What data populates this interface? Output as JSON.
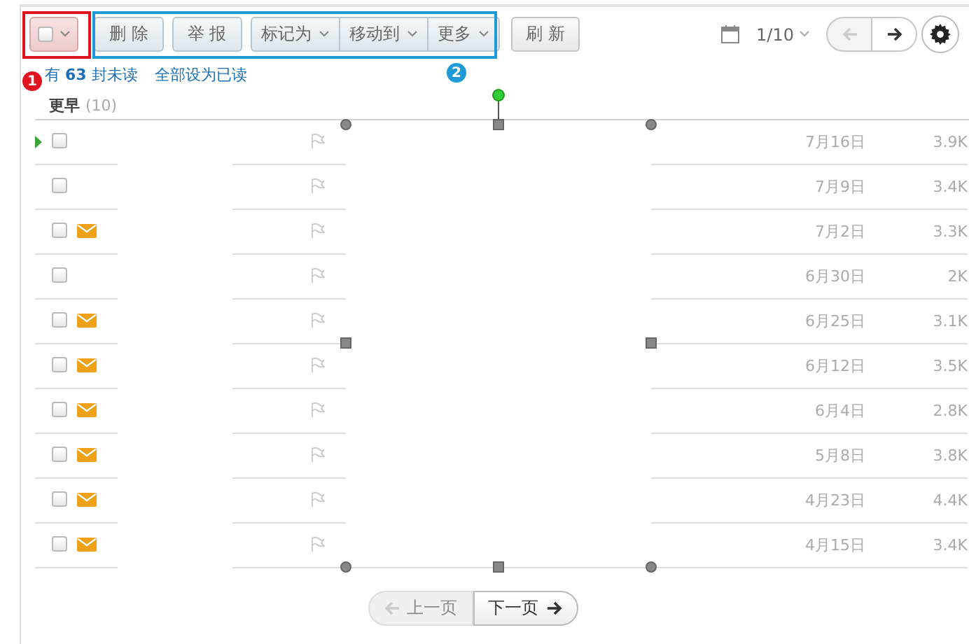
{
  "toolbar": {
    "select_all": {
      "checked": false
    },
    "delete_button": "删 除",
    "report_button": "举 报",
    "menu_group": [
      {
        "label": "标记为"
      },
      {
        "label": "移动到"
      },
      {
        "label": "更多"
      }
    ],
    "refresh_button": "刷 新",
    "page": "1/10",
    "prev": {
      "disabled": true
    },
    "next": {
      "disabled": false
    }
  },
  "annotations": [
    {
      "number": "1",
      "color": "#e0141e"
    },
    {
      "number": "2",
      "color": "#1e9bd7"
    }
  ],
  "unread_notice": "有 **63** 封未读",
  "mark_all_read": "全部设为已读",
  "group": {
    "title": "更早",
    "count": "(10)"
  },
  "rows": [
    {
      "current": true,
      "checked": false,
      "unread": false,
      "flagged": false,
      "date": "7月16日",
      "size": "3.9K"
    },
    {
      "current": false,
      "checked": false,
      "unread": false,
      "flagged": false,
      "date": "7月9日",
      "size": "3.4K"
    },
    {
      "current": false,
      "checked": false,
      "unread": true,
      "flagged": false,
      "date": "7月2日",
      "size": "3.3K"
    },
    {
      "current": false,
      "checked": false,
      "unread": false,
      "flagged": false,
      "date": "6月30日",
      "size": "2K"
    },
    {
      "current": false,
      "checked": false,
      "unread": true,
      "flagged": false,
      "date": "6月25日",
      "size": "3.1K"
    },
    {
      "current": false,
      "checked": false,
      "unread": true,
      "flagged": false,
      "date": "6月12日",
      "size": "3.5K"
    },
    {
      "current": false,
      "checked": false,
      "unread": true,
      "flagged": false,
      "date": "6月4日",
      "size": "2.8K"
    },
    {
      "current": false,
      "checked": false,
      "unread": true,
      "flagged": false,
      "date": "5月8日",
      "size": "3.8K"
    },
    {
      "current": false,
      "checked": false,
      "unread": true,
      "flagged": false,
      "date": "4月23日",
      "size": "4.4K"
    },
    {
      "current": false,
      "checked": false,
      "unread": true,
      "flagged": false,
      "date": "4月15日",
      "size": "3.4K"
    }
  ],
  "pager": {
    "prev": {
      "label": "上一页",
      "disabled": true
    },
    "next": {
      "label": "下一页",
      "disabled": false
    }
  }
}
